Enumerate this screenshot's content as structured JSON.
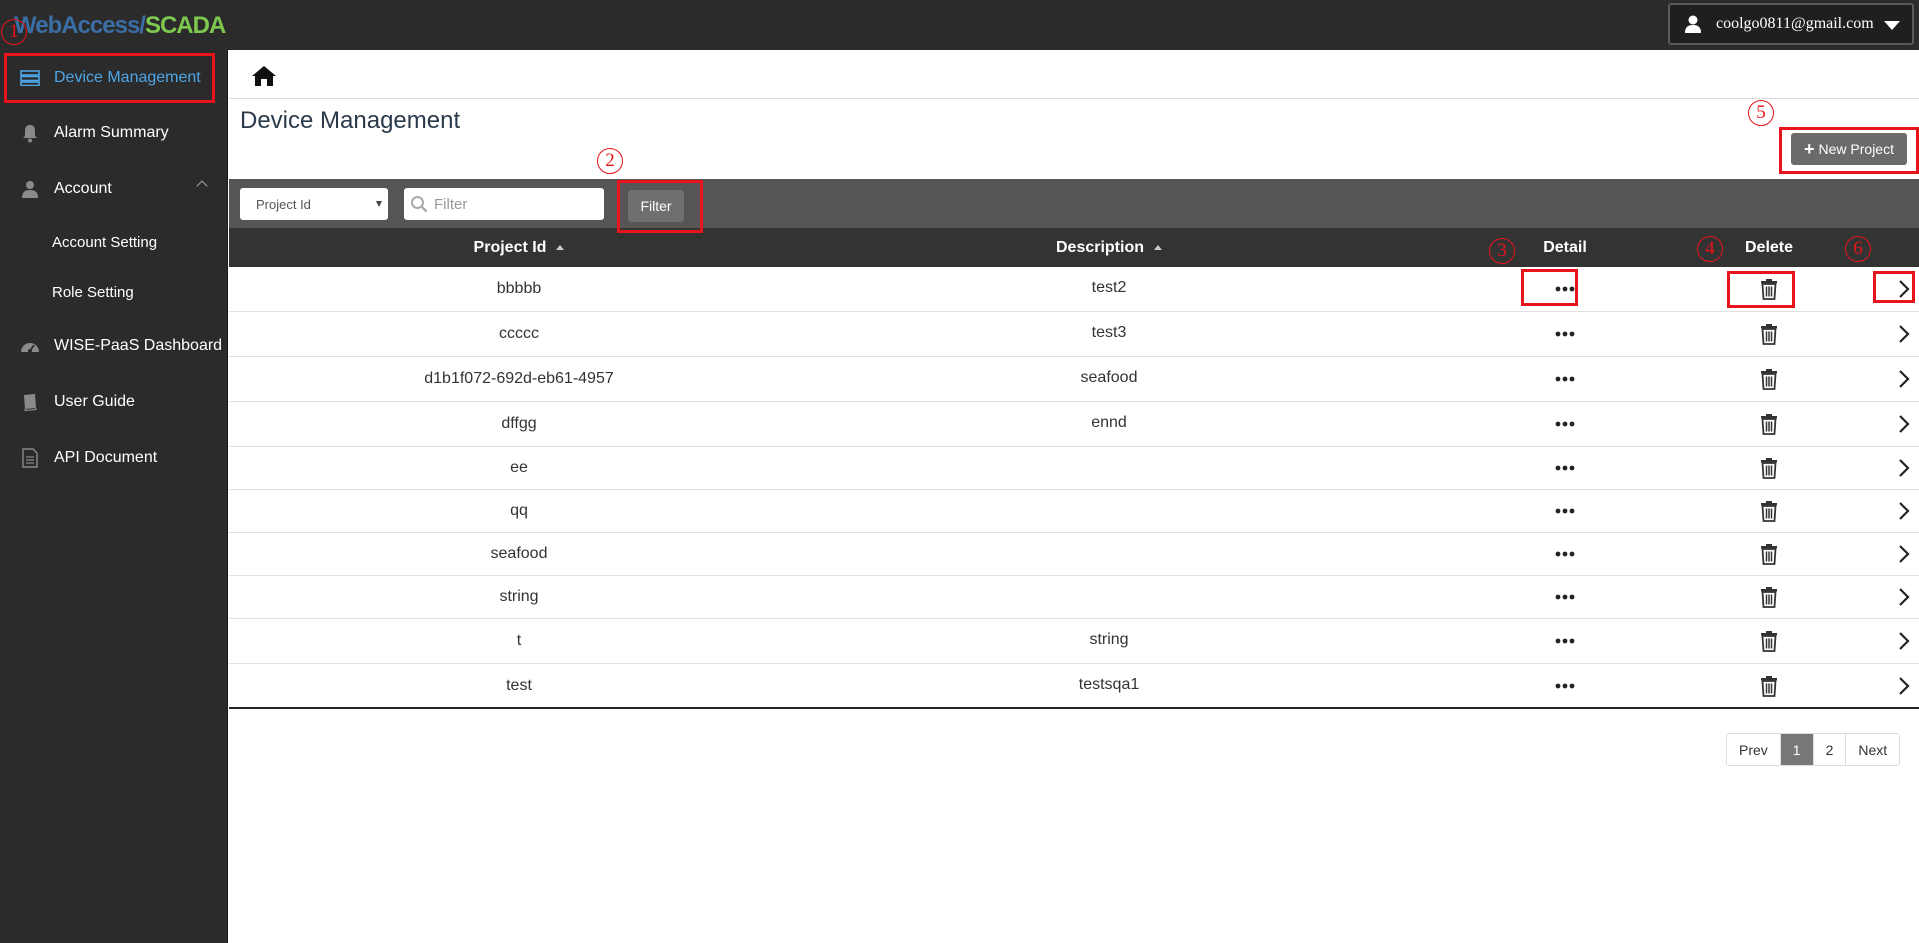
{
  "app": {
    "logo_part1": "WebAccess/",
    "logo_part2": "SCADA"
  },
  "user": {
    "email": "coolgo0811@gmail.com"
  },
  "sidebar": {
    "items": [
      {
        "label": "Device Management",
        "icon": "server-icon"
      },
      {
        "label": "Alarm Summary",
        "icon": "bell-icon"
      },
      {
        "label": "Account",
        "icon": "user-icon"
      },
      {
        "label": "Account Setting"
      },
      {
        "label": "Role Setting"
      },
      {
        "label": "WISE-PaaS Dashboard",
        "icon": "dashboard-icon"
      },
      {
        "label": "User Guide",
        "icon": "book-icon"
      },
      {
        "label": "API Document",
        "icon": "document-icon"
      }
    ]
  },
  "page": {
    "title": "Device Management",
    "new_project_label": "New Project"
  },
  "filter": {
    "select_value": "Project Id",
    "placeholder": "Filter",
    "button_label": "Filter"
  },
  "table": {
    "columns": [
      "Project Id",
      "Description",
      "Detail",
      "Delete"
    ],
    "rows": [
      {
        "id": "bbbbb",
        "desc": "test2"
      },
      {
        "id": "ccccc",
        "desc": "test3"
      },
      {
        "id": "d1b1f072-692d-eb61-4957",
        "desc": "seafood"
      },
      {
        "id": "dffgg",
        "desc": "ennd"
      },
      {
        "id": "ee",
        "desc": ""
      },
      {
        "id": "qq",
        "desc": ""
      },
      {
        "id": "seafood",
        "desc": ""
      },
      {
        "id": "string",
        "desc": ""
      },
      {
        "id": "t",
        "desc": "string"
      },
      {
        "id": "test",
        "desc": "testsqa1"
      }
    ]
  },
  "pagination": {
    "prev": "Prev",
    "pages": [
      "1",
      "2"
    ],
    "current": "1",
    "next": "Next"
  },
  "annotations": [
    "1",
    "2",
    "3",
    "4",
    "5",
    "6"
  ],
  "colors": {
    "annotation": "#e8141b",
    "active_nav": "#4da6e8",
    "sidebar_bg": "#2b2b2b",
    "header_bg": "#333333"
  }
}
